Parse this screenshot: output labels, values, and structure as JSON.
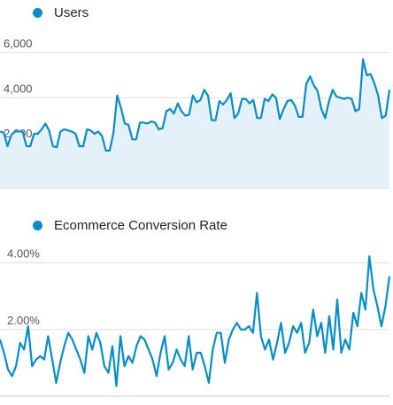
{
  "chart_data": [
    {
      "type": "area",
      "legend": "Users",
      "color": "#058dc7",
      "fill": "#e5f1f8",
      "yticks": [
        "6,000",
        "4,000",
        "2,000"
      ],
      "ytick_values": [
        6000,
        4000,
        2000
      ],
      "ylim": [
        0,
        7000
      ],
      "grid": true,
      "values": [
        2500,
        2450,
        1850,
        2350,
        2500,
        2500,
        2500,
        1850,
        1850,
        2400,
        2400,
        2600,
        2850,
        2550,
        1850,
        1800,
        2500,
        2600,
        2550,
        2500,
        2400,
        1850,
        1850,
        2600,
        2550,
        2400,
        2500,
        2300,
        1650,
        1650,
        2450,
        4100,
        3550,
        2850,
        2800,
        2150,
        2150,
        2900,
        2900,
        2850,
        2950,
        2900,
        2600,
        2650,
        3400,
        3500,
        3300,
        3750,
        3400,
        3200,
        3250,
        4100,
        3800,
        3900,
        4350,
        4100,
        3000,
        3000,
        3850,
        3700,
        3900,
        4200,
        3100,
        3300,
        3950,
        3950,
        3750,
        3900,
        3100,
        3100,
        3950,
        3850,
        4150,
        4000,
        3050,
        3500,
        3850,
        3900,
        3650,
        3150,
        3150,
        4600,
        4950,
        4550,
        4300,
        3500,
        3100,
        3850,
        4350,
        4050,
        4000,
        3950,
        4000,
        3950,
        3400,
        3500,
        5700,
        5000,
        5050,
        4650,
        4100,
        3100,
        3200,
        4350
      ]
    },
    {
      "type": "line",
      "legend": "Ecommerce Conversion Rate",
      "color": "#058dc7",
      "yticks": [
        "4.00%",
        "2.00%"
      ],
      "ytick_values": [
        4.0,
        2.0
      ],
      "ylim": [
        0,
        4.55
      ],
      "grid": true,
      "values": [
        1.7,
        1.3,
        0.8,
        0.6,
        0.9,
        1.6,
        1.4,
        2.1,
        0.9,
        1.1,
        1.2,
        1.1,
        1.8,
        1.1,
        0.4,
        1.0,
        1.5,
        1.9,
        1.7,
        1.4,
        1.1,
        0.7,
        1.8,
        1.4,
        1.9,
        1.6,
        0.9,
        0.7,
        1.5,
        0.3,
        1.8,
        0.9,
        1.2,
        1.0,
        1.5,
        1.8,
        1.7,
        1.4,
        1.1,
        0.6,
        1.3,
        1.8,
        0.8,
        1.0,
        1.4,
        1.1,
        0.9,
        1.8,
        0.8,
        1.3,
        1.3,
        0.9,
        0.4,
        1.4,
        1.9,
        1.9,
        1.0,
        1.7,
        2.0,
        2.2,
        2.0,
        2.0,
        2.1,
        1.9,
        3.1,
        1.8,
        1.4,
        1.7,
        1.1,
        1.6,
        2.2,
        1.3,
        1.6,
        2.1,
        1.9,
        2.2,
        1.3,
        1.6,
        2.6,
        1.8,
        2.2,
        1.3,
        2.4,
        1.4,
        2.9,
        1.3,
        1.7,
        1.4,
        2.5,
        2.1,
        3.1,
        2.6,
        4.2,
        3.2,
        2.7,
        2.1,
        2.7,
        3.6
      ]
    }
  ]
}
